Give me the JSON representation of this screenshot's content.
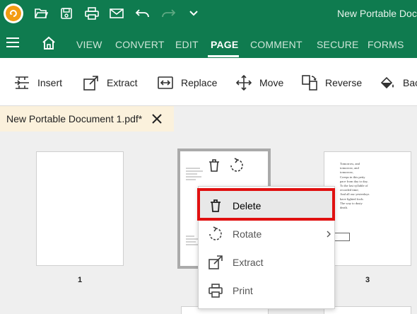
{
  "window": {
    "title": "New Portable Docu"
  },
  "menu": {
    "items": [
      "VIEW",
      "CONVERT",
      "EDIT",
      "PAGE",
      "COMMENT",
      "SECURE",
      "FORMS"
    ],
    "active": "PAGE"
  },
  "toolbar": {
    "insert": "Insert",
    "extract": "Extract",
    "replace": "Replace",
    "move": "Move",
    "reverse": "Reverse",
    "background": "Bac"
  },
  "document_tab": {
    "label": "New Portable Document 1.pdf*"
  },
  "pages": {
    "page1": "1",
    "page3": "3",
    "page3_text": [
      "Tomorrow, and",
      "tomorrow, and",
      "tomorrow,",
      "Creeps in this petty",
      "pace from day to day,",
      "To the last syllable of",
      "recorded time;",
      "And all our yesterdays",
      "have lighted fools",
      "The way to dusty",
      "death."
    ]
  },
  "context_menu": {
    "delete": "Delete",
    "rotate": "Rotate",
    "extract": "Extract",
    "print": "Print"
  },
  "colors": {
    "brand_green": "#0f7b4f",
    "highlight_red": "#e01010",
    "tab_bg": "#fbf1dc"
  }
}
